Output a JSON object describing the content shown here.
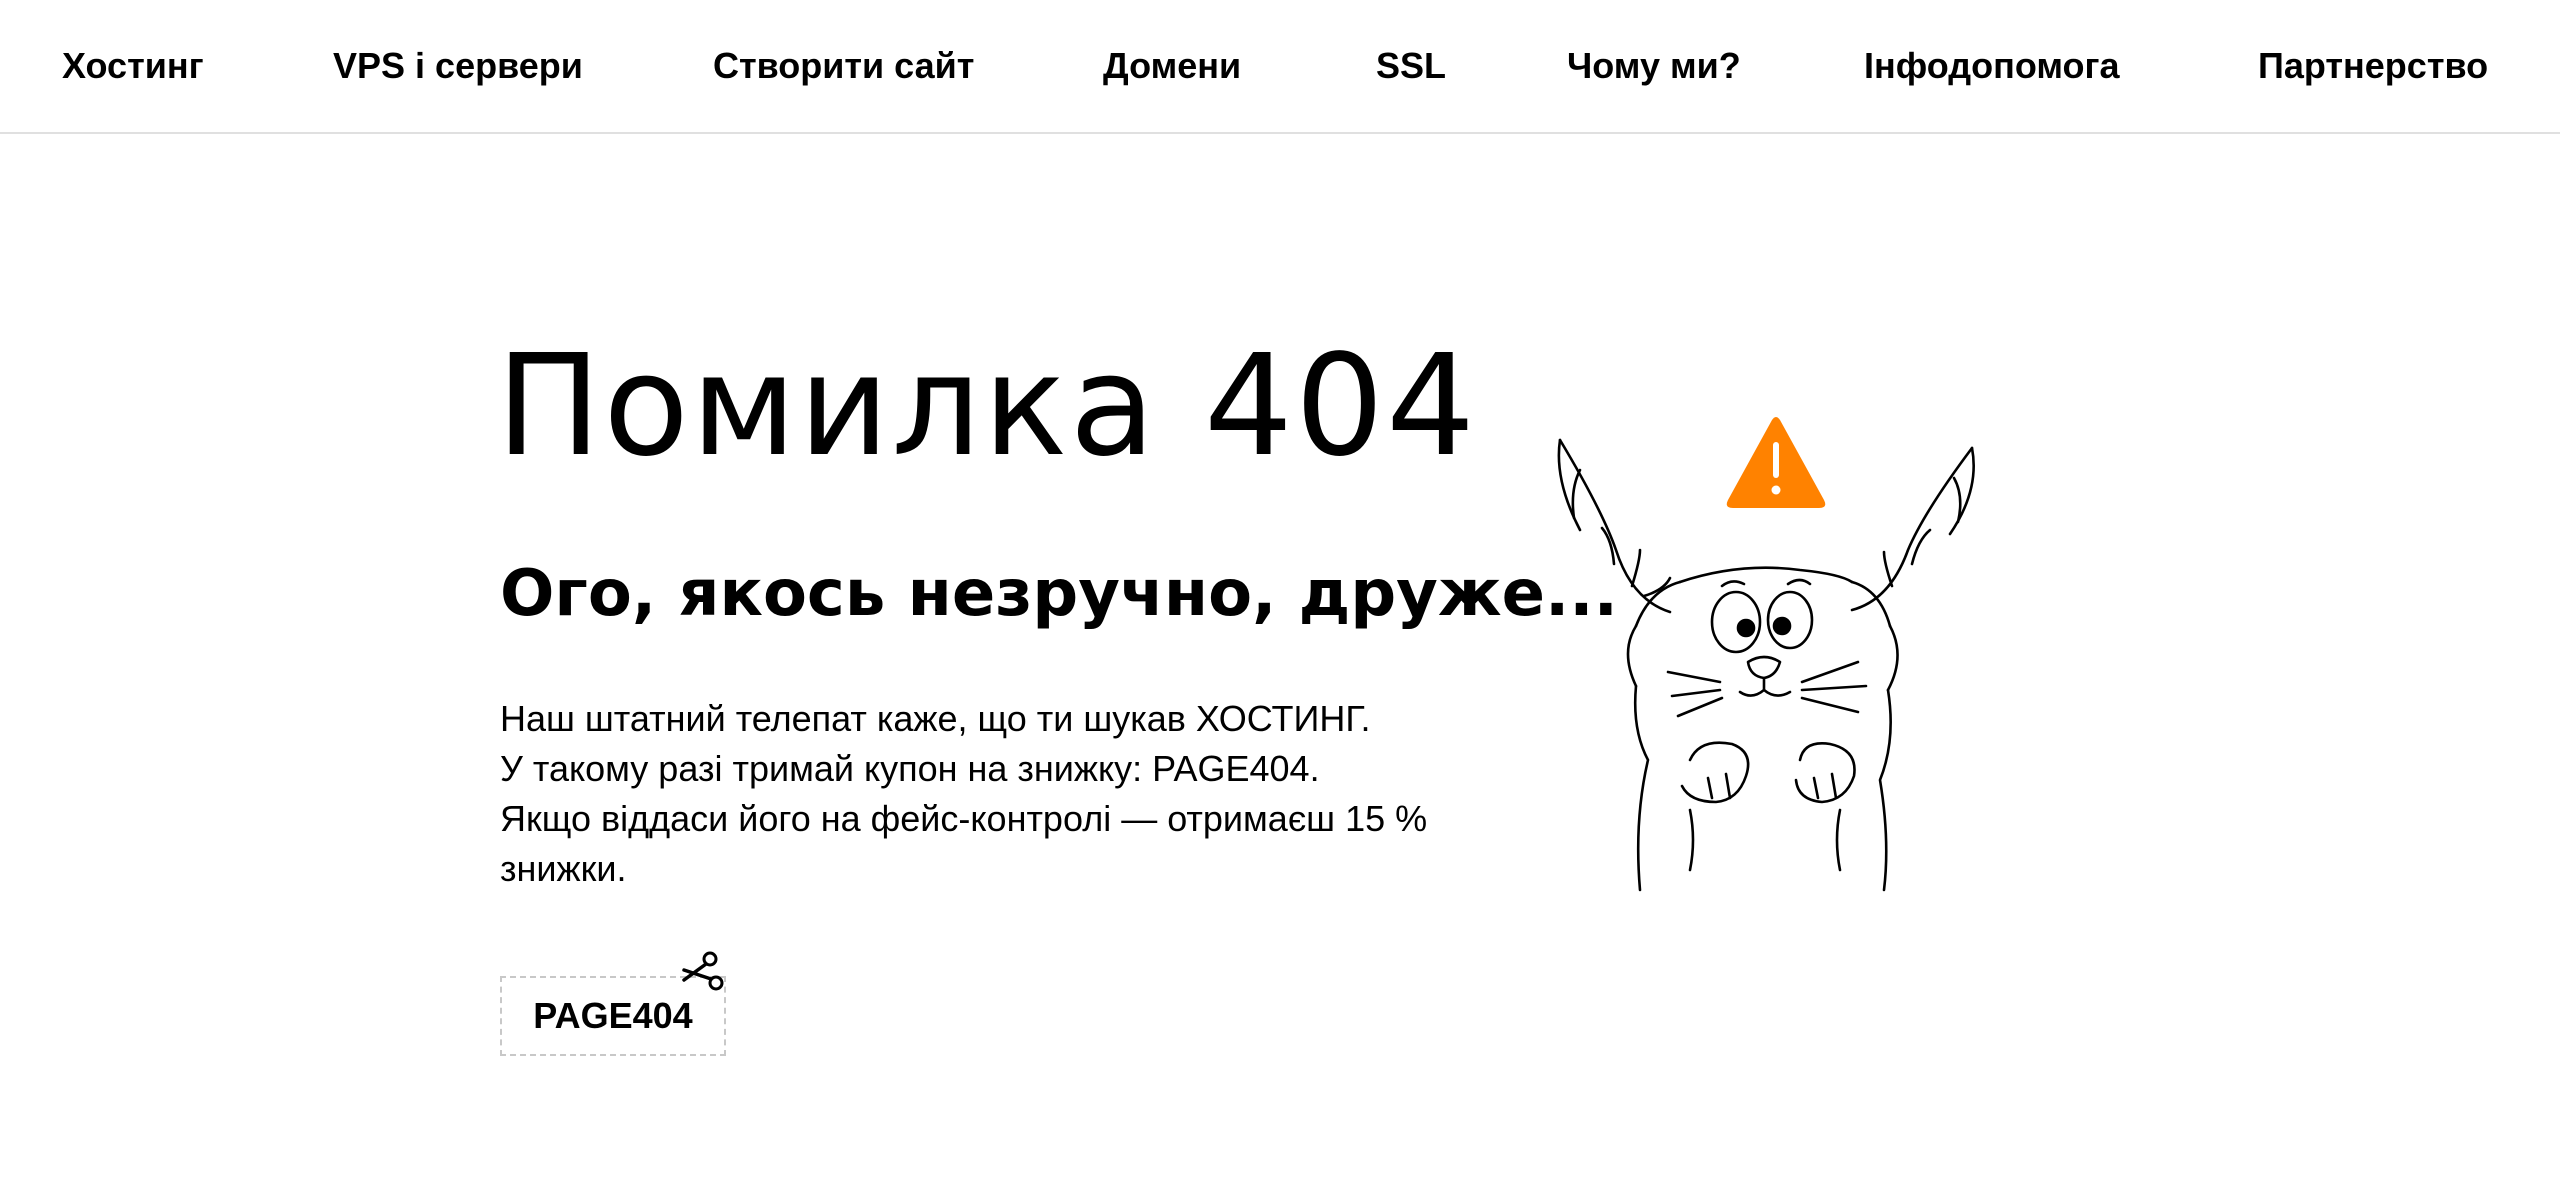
{
  "nav": {
    "items": [
      {
        "label": "Хостинг"
      },
      {
        "label": "VPS і сервери"
      },
      {
        "label": "Створити сайт"
      },
      {
        "label": "Домени"
      },
      {
        "label": "SSL"
      },
      {
        "label": "Чому ми?"
      },
      {
        "label": "Інфодопомога"
      },
      {
        "label": "Партнерство"
      }
    ]
  },
  "main": {
    "title": "Помилка 404",
    "subtitle": "Ого, якось незручно, друже...",
    "paragraph_lines": [
      "Наш штатний телепат каже, що ти шукав ХОСТИНГ.",
      "У такому разі тримай купон на знижку: PAGE404.",
      "Якщо віддаси його на фейс-контролі — отримаєш 15 %",
      "знижки."
    ],
    "coupon_code": "PAGE404"
  },
  "icons": {
    "scissors": "scissors-icon",
    "warning": "warning-triangle-icon",
    "illustration": "cat-with-antlers-illustration"
  },
  "colors": {
    "warning": "#FF8200",
    "nav_border": "#e0e0e0",
    "coupon_border": "#c8c8c8"
  }
}
